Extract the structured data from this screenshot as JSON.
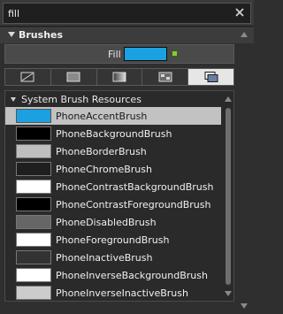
{
  "search": {
    "value": "fill",
    "clear_icon": "close-icon"
  },
  "section": {
    "title": "Brushes"
  },
  "brush": {
    "label": "Fill",
    "color": "#1ba1e2",
    "marker_color": "#8cc63f"
  },
  "tabs": [
    {
      "icon": "no-brush-icon",
      "active": false
    },
    {
      "icon": "solid-color-brush-icon",
      "active": false
    },
    {
      "icon": "gradient-brush-icon",
      "active": false
    },
    {
      "icon": "tile-brush-icon",
      "active": false
    },
    {
      "icon": "brush-resources-icon",
      "active": true
    }
  ],
  "resources": {
    "group_title": "System Brush Resources",
    "items": [
      {
        "label": "PhoneAccentBrush",
        "color": "#1ba1e2",
        "selected": true
      },
      {
        "label": "PhoneBackgroundBrush",
        "color": "#000000",
        "selected": false
      },
      {
        "label": "PhoneBorderBrush",
        "color": "#bfbfbf",
        "selected": false
      },
      {
        "label": "PhoneChromeBrush",
        "color": "#1f1f1f",
        "selected": false
      },
      {
        "label": "PhoneContrastBackgroundBrush",
        "color": "#ffffff",
        "selected": false
      },
      {
        "label": "PhoneContrastForegroundBrush",
        "color": "#000000",
        "selected": false
      },
      {
        "label": "PhoneDisabledBrush",
        "color": "#666666",
        "selected": false
      },
      {
        "label": "PhoneForegroundBrush",
        "color": "#ffffff",
        "selected": false
      },
      {
        "label": "PhoneInactiveBrush",
        "color": "#333333",
        "selected": false
      },
      {
        "label": "PhoneInverseBackgroundBrush",
        "color": "#ffffff",
        "selected": false
      },
      {
        "label": "PhoneInverseInactiveBrush",
        "color": "#cccccc",
        "selected": false
      }
    ]
  }
}
